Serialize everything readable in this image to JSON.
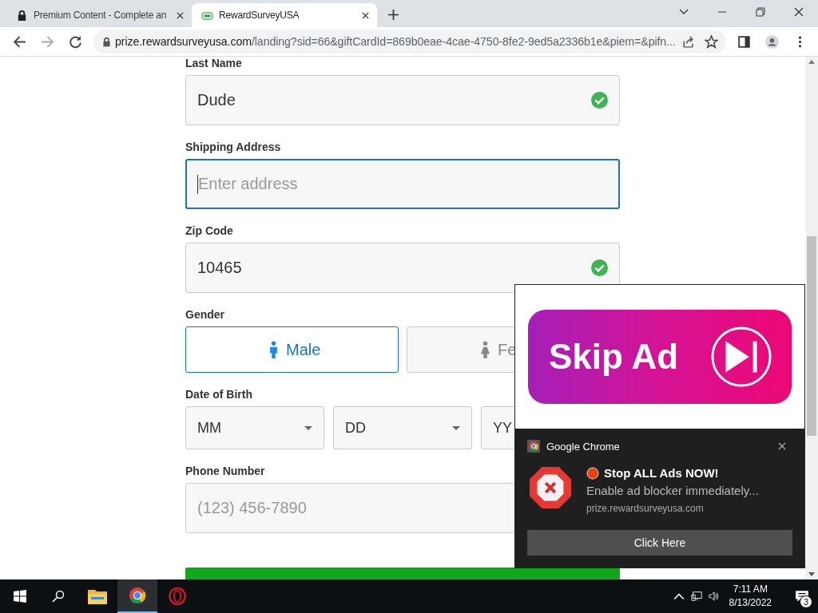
{
  "browser": {
    "tabs": [
      {
        "title": "Premium Content - Complete an",
        "selected": false
      },
      {
        "title": "RewardSurveyUSA",
        "selected": true
      }
    ],
    "address": {
      "host": "prize.rewardsurveyusa.com",
      "path": "/landing?sid=66&giftCardId=869b0eae-4cae-4750-8fe2-9ed5a2336b1e&piem=&pifn..."
    }
  },
  "form": {
    "fields": [
      {
        "kind": "text",
        "label": "Last Name",
        "value": "Dude",
        "valid": true,
        "focused": false
      },
      {
        "kind": "text",
        "label": "Shipping Address",
        "placeholder": "Enter address",
        "valid": false,
        "focused": true
      },
      {
        "kind": "text",
        "label": "Zip Code",
        "value": "10465",
        "valid": true,
        "focused": false
      },
      {
        "kind": "gender",
        "label": "Gender",
        "options": [
          {
            "label": "Male",
            "selected": true
          },
          {
            "label": "Fe",
            "selected": false
          }
        ]
      },
      {
        "kind": "date",
        "label": "Date of Birth",
        "selects": [
          "MM",
          "DD",
          "YY"
        ]
      },
      {
        "kind": "text",
        "label": "Phone Number",
        "placeholder": "(123) 456-7890",
        "focused": false
      }
    ]
  },
  "ad": {
    "banner": "Skip Ad",
    "notification": {
      "app": "Google Chrome",
      "title": "Stop ALL Ads NOW!",
      "body": "Enable ad blocker immediately...",
      "source": "prize.rewardsurveyusa.com",
      "button": "Click Here"
    }
  },
  "taskbar": {
    "apps": [
      {
        "kind": "explorer",
        "active": false
      },
      {
        "kind": "chrome",
        "active": true
      },
      {
        "kind": "opera",
        "active": false
      }
    ],
    "time": "7:11 AM",
    "date": "8/13/2022",
    "notifications": "3"
  }
}
